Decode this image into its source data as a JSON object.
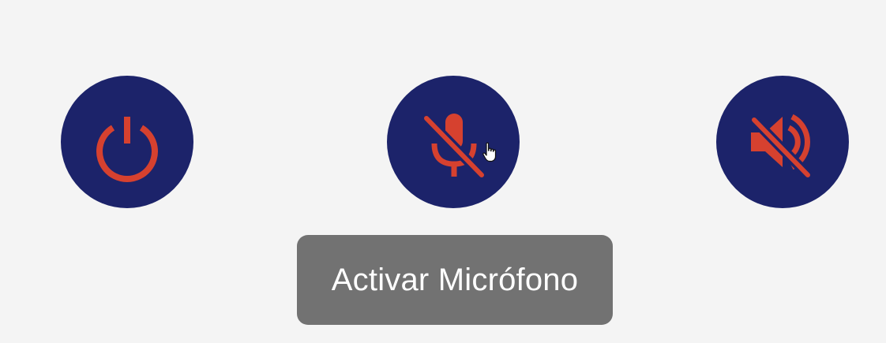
{
  "colors": {
    "background": "#f4f4f4",
    "button_fill": "#1c236a",
    "icon_accent": "#d6412f",
    "tooltip_bg": "#727272",
    "tooltip_text": "#ffffff"
  },
  "controls": {
    "power": {
      "icon": "power-icon"
    },
    "microphone": {
      "icon": "mic-off-icon"
    },
    "sound": {
      "icon": "volume-off-icon"
    }
  },
  "tooltip": {
    "text": "Activar Micrófono"
  }
}
